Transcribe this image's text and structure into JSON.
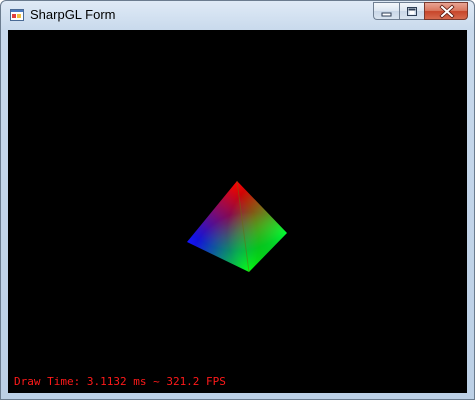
{
  "window": {
    "title": "SharpGL Form"
  },
  "icons": {
    "app": "app-window-icon",
    "minimize": "minimize-icon",
    "maximize": "maximize-icon",
    "close": "close-icon"
  },
  "viewport": {
    "background": "#000000",
    "shape": "rgb-gradient-pyramid",
    "vertex_colors": {
      "top": "#ff0000",
      "left": "#0000ff",
      "right": "#00ff00",
      "bottom": "#00ff00"
    },
    "status_text": "Draw Time: 3.1132 ms ~ 321.2 FPS",
    "status_color": "#ff1a1a"
  }
}
